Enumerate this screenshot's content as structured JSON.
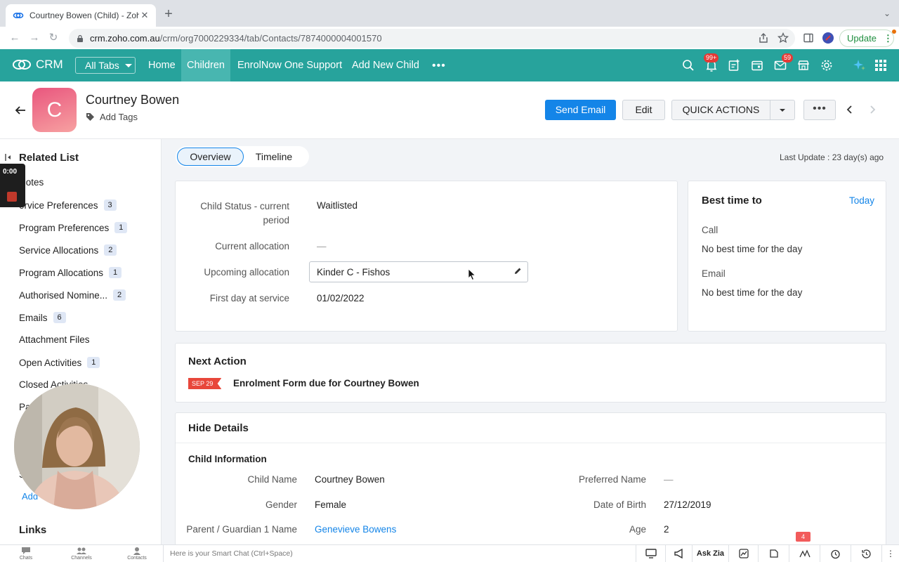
{
  "browser": {
    "tab_title": "Courtney Bowen (Child) - Zoho",
    "url_host": "crm.zoho.com.au",
    "url_path": "/crm/org7000229334/tab/Contacts/7874000004001570",
    "update_label": "Update"
  },
  "crm_nav": {
    "logo": "CRM",
    "all_tabs": "All Tabs",
    "links": [
      "Home",
      "Children",
      "EnrolNow One Support",
      "Add New Child"
    ],
    "notification_badge": "99+",
    "mail_badge": "59",
    "brand_color": "#27a39c"
  },
  "record": {
    "avatar_initial": "C",
    "name": "Courtney Bowen",
    "add_tags": "Add Tags",
    "send_email": "Send Email",
    "edit": "Edit",
    "quick_actions": "QUICK ACTIONS"
  },
  "sidebar": {
    "title": "Related List",
    "items": [
      {
        "label": "Notes",
        "count": ""
      },
      {
        "label": "ervice Preferences",
        "count": "3"
      },
      {
        "label": "Program Preferences",
        "count": "1"
      },
      {
        "label": "Service Allocations",
        "count": "2"
      },
      {
        "label": "Program Allocations",
        "count": "1"
      },
      {
        "label": "Authorised Nomine...",
        "count": "2"
      },
      {
        "label": "Emails",
        "count": "6"
      },
      {
        "label": "Attachment Files",
        "count": ""
      },
      {
        "label": "Open Activities",
        "count": "1"
      },
      {
        "label": "Closed Activities",
        "count": ""
      },
      {
        "label": "Pa",
        "count": ""
      },
      {
        "label": "S",
        "count": ""
      }
    ],
    "add_link": "Add",
    "links_title": "Links"
  },
  "recording": {
    "time": "0:00"
  },
  "main": {
    "tabs": [
      "Overview",
      "Timeline"
    ],
    "last_update": "Last Update : 23 day(s) ago",
    "status_fields": [
      {
        "label_line1": "Child Status - current",
        "label_line2": "period",
        "value": "Waitlisted"
      },
      {
        "label_line1": "Current allocation",
        "value": "—"
      },
      {
        "label_line1": "Upcoming allocation",
        "value": "Kinder C - Fishos"
      },
      {
        "label_line1": "First day at service",
        "value": "01/02/2022"
      }
    ],
    "best_time": {
      "title": "Best time to",
      "today": "Today",
      "call_label": "Call",
      "call_value": "No best time for the day",
      "email_label": "Email",
      "email_value": "No best time for the day"
    },
    "next_action": {
      "title": "Next Action",
      "date": "SEP 29",
      "text": "Enrolment Form due for Courtney Bowen"
    },
    "details": {
      "title": "Hide Details",
      "section": "Child Information",
      "left": [
        {
          "label": "Child Name",
          "value": "Courtney Bowen"
        },
        {
          "label": "Gender",
          "value": "Female"
        },
        {
          "label": "Parent / Guardian 1 Name",
          "value": "Genevieve Bowens"
        }
      ],
      "right": [
        {
          "label": "Preferred Name",
          "value": "—"
        },
        {
          "label": "Date of Birth",
          "value": "27/12/2019"
        },
        {
          "label": "Age",
          "value": "2"
        }
      ]
    }
  },
  "bottom_bar": {
    "chats": "Chats",
    "channels": "Channels",
    "contacts": "Contacts",
    "smart_chat": "Here is your Smart Chat (Ctrl+Space)",
    "ask_zia": "Ask Zia",
    "badge": "4"
  }
}
